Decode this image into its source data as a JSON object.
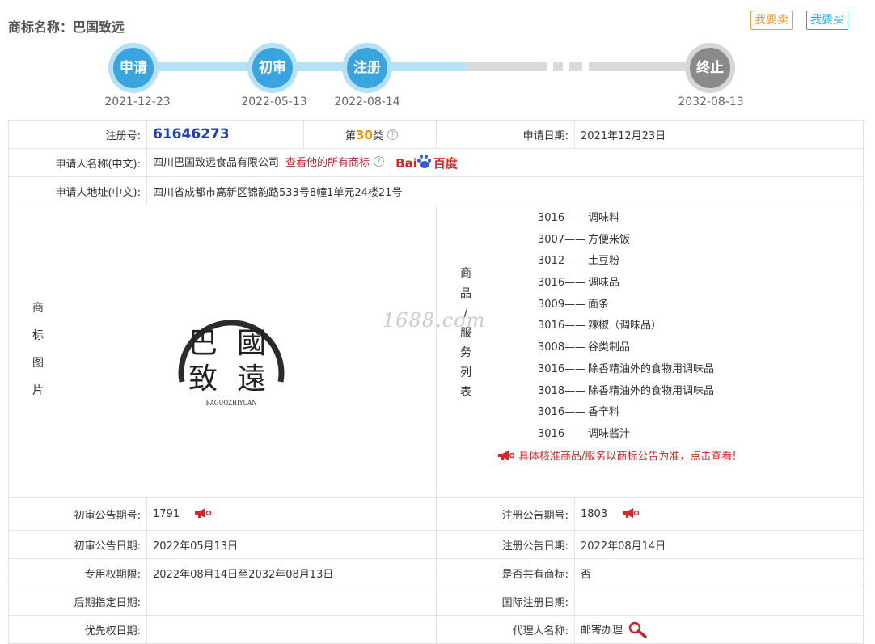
{
  "header": {
    "title": "商标名称：巴国致远",
    "sell_button": "我要卖",
    "buy_button": "我要买"
  },
  "timeline": {
    "steps": [
      {
        "label": "申请",
        "date": "2021-12-23"
      },
      {
        "label": "初审",
        "date": "2022-05-13"
      },
      {
        "label": "注册",
        "date": "2022-08-14"
      },
      {
        "label": "终止",
        "date": "2032-08-13"
      }
    ]
  },
  "info": {
    "reg_no_label": "注册号:",
    "reg_no": "61646273",
    "class_prefix": "第",
    "class_num": "30",
    "class_suffix": "类",
    "apply_date_label": "申请日期:",
    "apply_date": "2021年12月23日",
    "applicant_label": "申请人名称(中文):",
    "applicant": "四川巴国致远食品有限公司",
    "view_all_link": "查看他的所有商标",
    "baidu_text": "Bai",
    "baidu_zh": "百度",
    "address_label": "申请人地址(中文):",
    "address": "四川省成都市高新区锦韵路533号8幢1单元24楼21号",
    "image_label": [
      "商",
      "标",
      "图",
      "片"
    ],
    "goods_label": [
      "商",
      "品",
      "/",
      "服",
      "务",
      "列",
      "表"
    ],
    "logo_text": {
      "c1": "巴",
      "c2": "國",
      "c3": "致",
      "c4": "遠",
      "en": "BAGUOZHIYUAN"
    },
    "watermark": "1688.com",
    "goods": [
      {
        "code": "3016——",
        "name": "调味料"
      },
      {
        "code": "3007——",
        "name": "方便米饭"
      },
      {
        "code": "3012——",
        "name": "土豆粉"
      },
      {
        "code": "3016——",
        "name": "调味品"
      },
      {
        "code": "3009——",
        "name": "面条"
      },
      {
        "code": "3016——",
        "name": "辣椒（调味品）"
      },
      {
        "code": "3008——",
        "name": "谷类制品"
      },
      {
        "code": "3016——",
        "name": "除香精油外的食物用调味品"
      },
      {
        "code": "3018——",
        "name": "除香精油外的食物用调味品"
      },
      {
        "code": "3016——",
        "name": "香辛料"
      },
      {
        "code": "3016——",
        "name": "调味酱汁"
      }
    ],
    "goods_note": "具体核准商品/服务以商标公告为准，点击查看!",
    "prelim_no_label": "初审公告期号:",
    "prelim_no": "1791",
    "reg_pub_no_label": "注册公告期号:",
    "reg_pub_no": "1803",
    "prelim_date_label": "初审公告日期:",
    "prelim_date": "2022年05月13日",
    "reg_pub_date_label": "注册公告日期:",
    "reg_pub_date": "2022年08月14日",
    "exclusive_label": "专用权期限:",
    "exclusive": "2022年08月14日至2032年08月13日",
    "shared_label": "是否共有商标:",
    "shared": "否",
    "later_date_label": "后期指定日期:",
    "later_date": "",
    "intl_date_label": "国际注册日期:",
    "intl_date": "",
    "priority_label": "优先权日期:",
    "priority": "",
    "agent_label": "代理人名称:",
    "agent": "邮寄办理"
  },
  "colors": {
    "timeline_blue": "#3aa4de",
    "timeline_gray": "#8a8a8a",
    "reg_no": "#1a3fb8",
    "class_num": "#f08c00",
    "link_red": "#c1272d"
  },
  "icons": [
    "help-icon",
    "baidu-paw-icon",
    "megaphone-icon",
    "search-icon"
  ]
}
